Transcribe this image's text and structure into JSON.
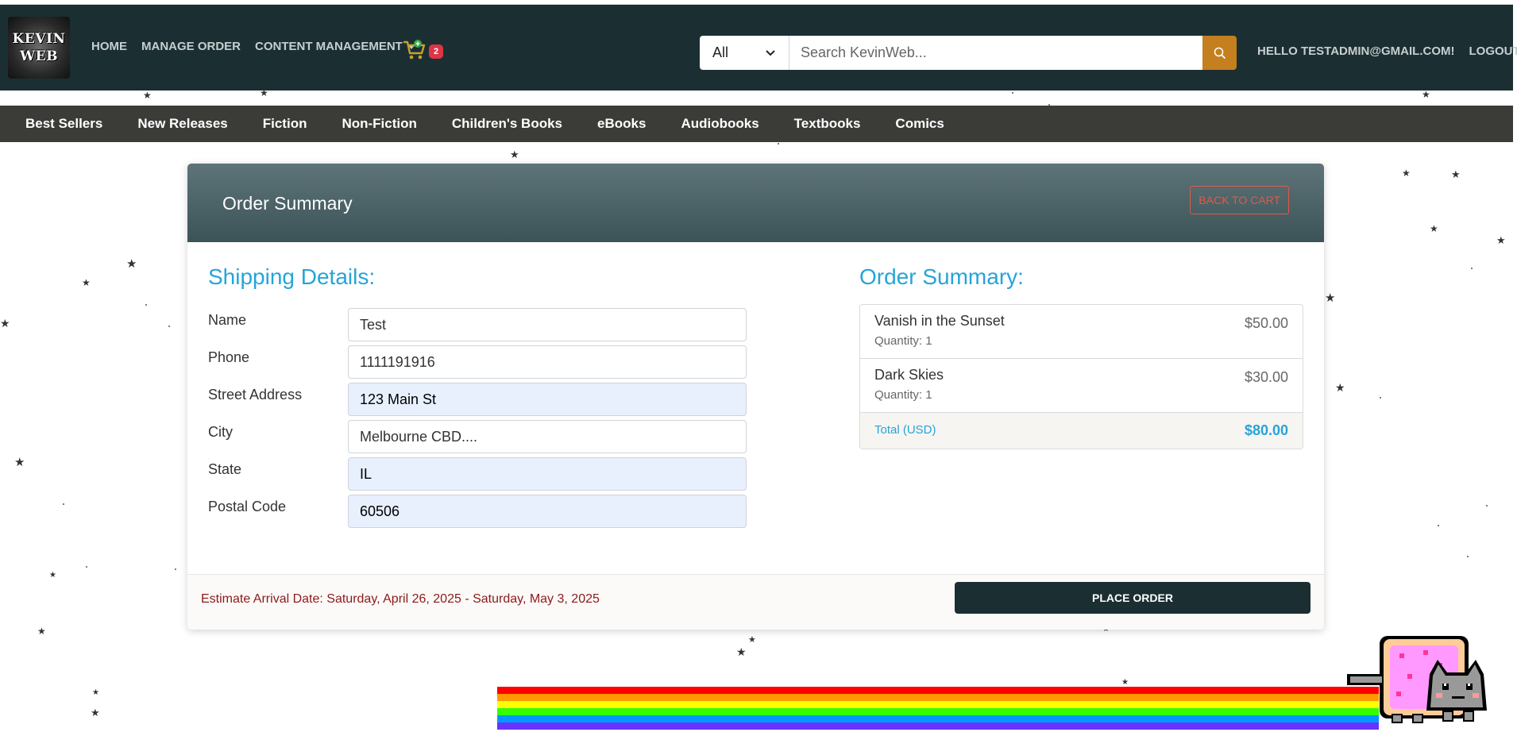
{
  "brand": {
    "logo_line1": "KEVIN",
    "logo_line2": "WEB"
  },
  "nav": {
    "home": "HOME",
    "manage_order": "MANAGE ORDER",
    "content_management": "CONTENT MANAGEMENT",
    "cart_count": "2"
  },
  "search": {
    "category": "All",
    "placeholder": "Search KevinWeb..."
  },
  "user": {
    "greeting": "HELLO TESTADMIN@GMAIL.COM!",
    "logout": "LOGOUT"
  },
  "categories": [
    "Best Sellers",
    "New Releases",
    "Fiction",
    "Non-Fiction",
    "Children's Books",
    "eBooks",
    "Audiobooks",
    "Textbooks",
    "Comics"
  ],
  "card": {
    "title": "Order Summary",
    "back_label": "BACK TO CART"
  },
  "shipping": {
    "title": "Shipping Details:",
    "fields": [
      {
        "label": "Name",
        "value": "Test"
      },
      {
        "label": "Phone",
        "value": "1111191916"
      },
      {
        "label": "Street Address",
        "value": "123 Main St"
      },
      {
        "label": "City",
        "value": "Melbourne CBD...."
      },
      {
        "label": "State",
        "value": "IL"
      },
      {
        "label": "Postal Code",
        "value": "60506"
      }
    ]
  },
  "summary": {
    "title": "Order Summary:",
    "items": [
      {
        "name": "Vanish in the Sunset",
        "quantity": "Quantity: 1",
        "price": "$50.00"
      },
      {
        "name": "Dark Skies",
        "quantity": "Quantity: 1",
        "price": "$30.00"
      }
    ],
    "total_label": "Total (USD)",
    "total_value": "$80.00"
  },
  "footer": {
    "eta": "Estimate Arrival Date: Saturday, April 26, 2025 - Saturday, May 3, 2025",
    "place_order": "PLACE ORDER"
  },
  "colors": {
    "navbar": "#1b2f33",
    "category_bar": "#3b3c38",
    "accent_blue": "#27a4d8",
    "search_button": "#c47f1f",
    "cart_badge": "#dc3545",
    "eta_text": "#8b1a1a"
  },
  "icons": {
    "search": "search-icon",
    "cart": "cart-icon",
    "dropdown": "chevron-down-icon"
  }
}
